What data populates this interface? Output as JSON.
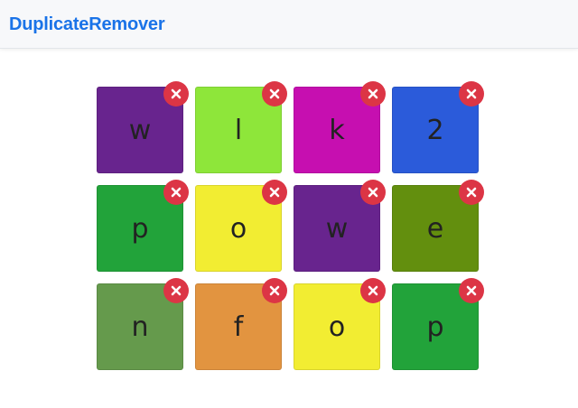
{
  "header": {
    "title": "DuplicateRemover",
    "title_color": "#1a73e8"
  },
  "remove_button": {
    "icon": "close-icon",
    "color": "#dc3545"
  },
  "tiles": [
    {
      "letter": "w",
      "color": "#68248e"
    },
    {
      "letter": "l",
      "color": "#8ee63a"
    },
    {
      "letter": "k",
      "color": "#c60fb0"
    },
    {
      "letter": "2",
      "color": "#2b5bda"
    },
    {
      "letter": "p",
      "color": "#22a33a"
    },
    {
      "letter": "o",
      "color": "#f2ed32"
    },
    {
      "letter": "w",
      "color": "#68248e"
    },
    {
      "letter": "e",
      "color": "#638f0e"
    },
    {
      "letter": "n",
      "color": "#659a4c"
    },
    {
      "letter": "f",
      "color": "#e29440"
    },
    {
      "letter": "o",
      "color": "#f2ed32"
    },
    {
      "letter": "p",
      "color": "#22a33a"
    }
  ]
}
